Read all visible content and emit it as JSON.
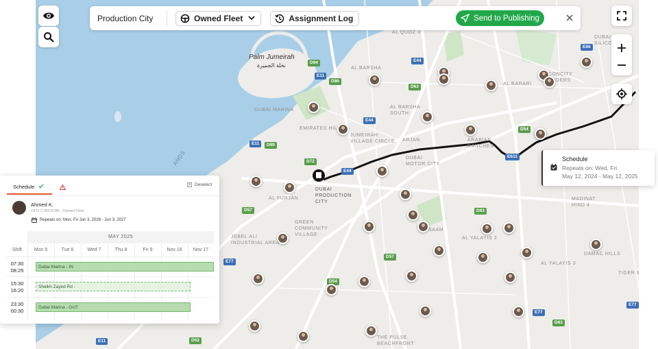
{
  "toolbar": {
    "title": "Production City",
    "fleet_label": "Owned Fleet",
    "log_label": "Assignment Log",
    "publish_label": "Send to Publishing"
  },
  "map": {
    "labels": {
      "palm_en": "Palm Jumeirah",
      "palm_ar": "نخلة الجميرة",
      "al_quoz": "AL QUOZ 3",
      "al_barsha": "AL BARSHA\nSOUTH",
      "al_barsha1": "AL BARSHA",
      "dubai_marina": "DUBAI MARINA",
      "emirates_hill": "EMIRATES HILL",
      "jvc": "JUMEIRAH\nVILLAGE CIRCLE",
      "arjan": "ARJAN",
      "barsha_south": "AL BARSHA\nSOUTH",
      "motor_city": "DUBAI\nMOTOR CITY",
      "arabian_ranches": "ARABIAN\nRANCHES",
      "al_barari": "AL BARARI",
      "concity": "CONCITY\nANDERS",
      "production_city": "DUBAI\nPRODUCTION\nCITY",
      "al_furjan": "AL FURJAN",
      "green_community": "GREEN\nCOMMUNITY\nVILLAGE",
      "jebel_ali": "JEBEL ALI\nINDUSTRIAL AREA",
      "al_yalayis2": "AL YALAYIS 2",
      "al_yalayis3": "AL YALAYIS 3",
      "madinat_hind": "MADINAT\nHIND 4",
      "damac_hills": "DAMAC HILLS",
      "tiger_woods": "TIGER WO",
      "pulse": "THE PULSE\nBEACHFRONT",
      "islands": "ANDS",
      "dubai_silicon": "DUBAI\nSILICO",
      "saam": "SAAM"
    },
    "roads": [
      "D94",
      "E11",
      "D86",
      "E44",
      "D63",
      "E44",
      "D99",
      "E11",
      "D72",
      "E44",
      "D54",
      "E611",
      "D63",
      "D57",
      "D57",
      "E77",
      "D54",
      "E77",
      "D63",
      "E77",
      "E11",
      "D53",
      "E66",
      "E311",
      "D61",
      "D62",
      "D65",
      "E311",
      "E611"
    ]
  },
  "popover": {
    "title": "Schedule",
    "repeats": "Repeats on: Wed, Fri",
    "dates": "May 12, 2024 - May 12, 2025"
  },
  "schedule": {
    "tab_label": "Schedule",
    "deselect_label": "Deselect",
    "driver_name": "Ahmed K.",
    "driver_meta": "+971 2 345 6789 · Owned Fleet",
    "repeat_text": "Repeats on: Mon, Fri Jun 3, 2026 - Jun 3, 2027",
    "month": "MAY 2025",
    "shift_header": "Shift",
    "days": [
      "Mon 5",
      "Tue 6",
      "Wed 7",
      "Thu 8",
      "Fri 9",
      "Nov 16",
      "Nov 17"
    ],
    "rows": [
      {
        "start": "07:30",
        "end": "08:25",
        "label": "Dubai Marina - IN"
      },
      {
        "start": "15:30",
        "end": "16:20",
        "label": "Sheikh Zayed Rd -"
      },
      {
        "start": "23:30",
        "end": "00:30",
        "label": "Dubai Marina - OUT"
      }
    ]
  },
  "colors": {
    "publish": "#22a84a",
    "route": "#111111",
    "water": "#a9cfe8",
    "tab_accent": "#e8552f",
    "shift_green": "#b6dcb0"
  }
}
